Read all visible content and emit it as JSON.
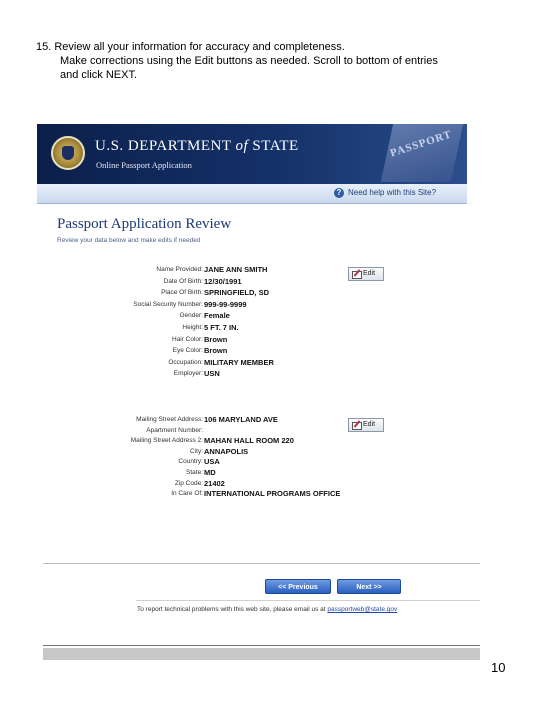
{
  "instructions": {
    "line1": "15.   Review all your information for accuracy and completeness.",
    "line2": "Make corrections using the Edit buttons as needed.  Scroll to bottom of entries",
    "line3": " and click NEXT."
  },
  "header": {
    "department_prefix": "U.S. DEPARTMENT ",
    "department_of": "of",
    "department_suffix": " STATE",
    "subtitle": "Online Passport Application",
    "watermark": "PASSPORT"
  },
  "help": {
    "label": "Need help with this Site?"
  },
  "page": {
    "title": "Passport Application Review",
    "subtitle": "Review your data below and make edits if needed"
  },
  "personal": {
    "edit_label": "Edit",
    "fields": [
      {
        "label": "Name Provided:",
        "value": "JANE ANN SMITH"
      },
      {
        "label": "Date Of Birth:",
        "value": "12/30/1991"
      },
      {
        "label": "Place Of Birth:",
        "value": "SPRINGFIELD, SD"
      },
      {
        "label": "Social Security Number:",
        "value": "999-99-9999"
      },
      {
        "label": "Gender:",
        "value": "Female"
      },
      {
        "label": "Height:",
        "value": "5 FT. 7 IN."
      },
      {
        "label": "Hair Color:",
        "value": "Brown"
      },
      {
        "label": "Eye Color:",
        "value": "Brown"
      },
      {
        "label": "Occupation:",
        "value": "MILITARY MEMBER"
      },
      {
        "label": "Employer:",
        "value": "USN"
      }
    ]
  },
  "address": {
    "edit_label": "Edit",
    "fields": [
      {
        "label": "Mailing Street Address:",
        "value": "106 MARYLAND AVE"
      },
      {
        "label": "Apartment Number:",
        "value": ""
      },
      {
        "label": "Mailing Street Address 2:",
        "value": "MAHAN HALL ROOM 220"
      },
      {
        "label": "City:",
        "value": "ANNAPOLIS"
      },
      {
        "label": "Country:",
        "value": "USA"
      },
      {
        "label": "State:",
        "value": "MD"
      },
      {
        "label": "Zip Code:",
        "value": "21402"
      },
      {
        "label": "In Care Of:",
        "value": "INTERNATIONAL PROGRAMS OFFICE"
      }
    ]
  },
  "nav": {
    "previous_label": "<< Previous",
    "next_label": "Next >>"
  },
  "footer": {
    "report_text": "To report technical problems with this web site, please email us at ",
    "report_email": "passportweb@state.gov"
  },
  "page_number": "10"
}
